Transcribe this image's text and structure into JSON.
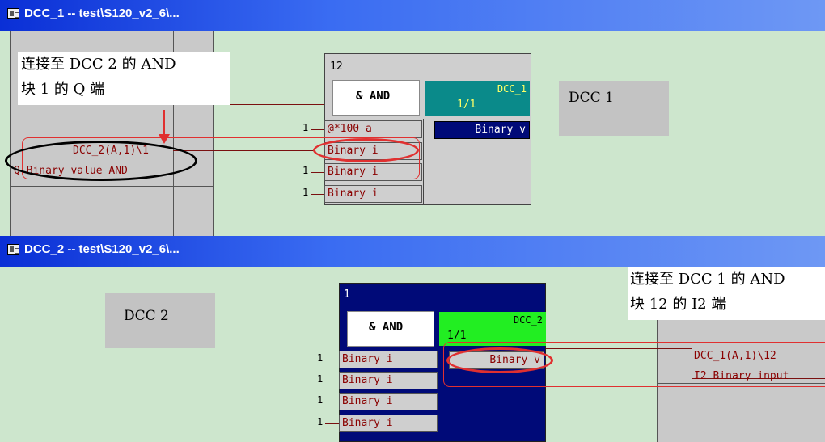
{
  "win1": {
    "title": "DCC_1 -- test\\S120_v2_6\\...",
    "block_number": "12",
    "block_type": "& AND",
    "block_chart": "DCC_1",
    "block_cycle": "1/1",
    "inputs": [
      "@*100 a",
      "Binary i",
      "Binary i",
      "Binary i"
    ],
    "output": "Binary v",
    "pin_num": "1",
    "chart_label": "DCC 1",
    "ref_line1": "DCC_2(A,1)\\1",
    "ref_line2": "Q Binary value AND",
    "note_line1": "连接至 DCC 2 的 AND",
    "note_line2": "块 1 的 Q 端"
  },
  "win2": {
    "title": "DCC_2 -- test\\S120_v2_6\\...",
    "block_number": "1",
    "block_type": "& AND",
    "block_chart": "DCC_2",
    "block_cycle": "1/1",
    "inputs": [
      "Binary i",
      "Binary i",
      "Binary i",
      "Binary i"
    ],
    "output": "Binary v",
    "pin_num": "1",
    "chart_label": "DCC 2",
    "ref_line1": "DCC_1(A,1)\\12",
    "ref_line2": "I2 Binary input",
    "note_line1": "连接至 DCC 1 的 AND",
    "note_line2": "块 12 的 I2 端"
  },
  "colors": {
    "title_bar": "#0a2fd6",
    "canvas": "#cde6cd",
    "teal_header": "#0a8a8a",
    "green_header": "#22ee22",
    "navy_block": "#000a78",
    "wire": "#7a1010",
    "annotation_red": "#e03030"
  }
}
